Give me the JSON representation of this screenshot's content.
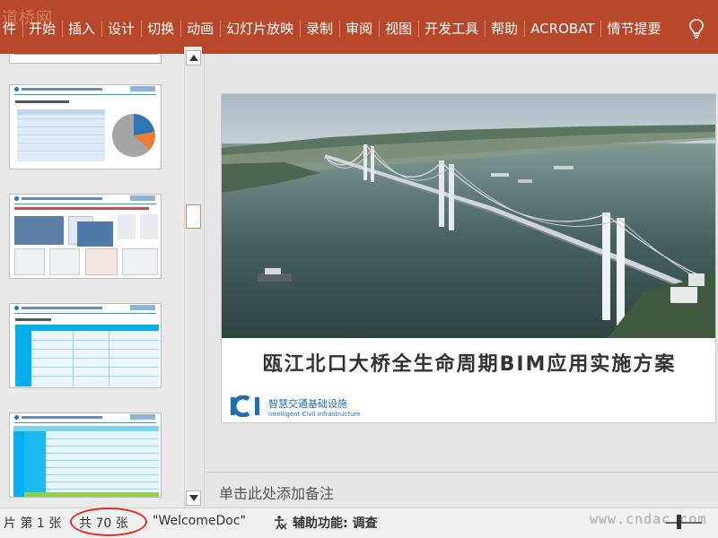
{
  "ribbon": {
    "watermark": "道桥网",
    "tabs": [
      "件",
      "开始",
      "插入",
      "设计",
      "切换",
      "动画",
      "幻灯片放映",
      "录制",
      "审阅",
      "视图",
      "开发工具",
      "帮助",
      "ACROBAT",
      "情节提要"
    ],
    "tell_me_icon": "lightbulb-icon"
  },
  "thumbnails": [
    {
      "type": "table-pie",
      "accent": "#1ea1e3"
    },
    {
      "type": "images",
      "accent": "#1ea1e3"
    },
    {
      "type": "table",
      "accent": "#00b0f0"
    },
    {
      "type": "dense-table",
      "accent": "#00b0f0"
    }
  ],
  "slide": {
    "title": "瓯江北口大桥全生命周期BIM应用实施方案",
    "logo_text": "ICI",
    "logo_cn": "智慧交通基础设施",
    "logo_en": "Intelligent Civil infrastructure",
    "brand_color": "#1b6fb5"
  },
  "notes": {
    "placeholder": "单击此处添加备注"
  },
  "status": {
    "slide_info": "片 第 1 张",
    "total": "共 70 张",
    "theme": "\"WelcomeDoc\"",
    "accessibility": "辅助功能: 调查",
    "watermark": "www.cndac.com"
  },
  "colors": {
    "ribbon": "#b7472a",
    "highlight": "#e22c2c"
  }
}
